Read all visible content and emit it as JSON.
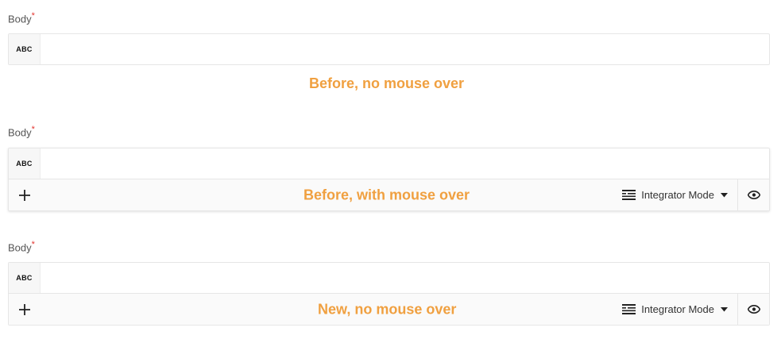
{
  "sections": [
    {
      "label": "Body",
      "required_mark": "*",
      "prefix_badge": "ABC",
      "note": "Before, no mouse over"
    },
    {
      "label": "Body",
      "required_mark": "*",
      "prefix_badge": "ABC",
      "note": "Before, with mouse over",
      "toolbar": {
        "add_icon": "plus-icon",
        "mode_icon": "lines-icon",
        "mode_label": "Integrator Mode",
        "caret_icon": "caret-down-icon",
        "preview_icon": "eye-icon"
      }
    },
    {
      "label": "Body",
      "required_mark": "*",
      "prefix_badge": "ABC",
      "note": "New, no mouse over",
      "toolbar": {
        "add_icon": "plus-icon",
        "mode_icon": "lines-icon",
        "mode_label": "Integrator Mode",
        "caret_icon": "caret-down-icon",
        "preview_icon": "eye-icon"
      }
    }
  ],
  "colors": {
    "note": "#f0a040",
    "required": "#e3342f",
    "border": "#e6e6e6"
  }
}
